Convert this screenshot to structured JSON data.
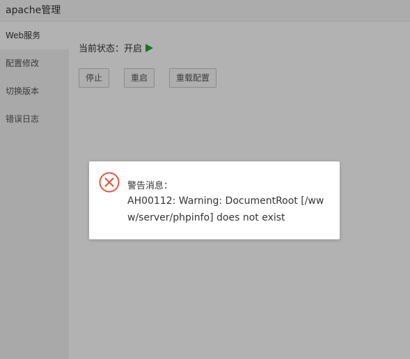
{
  "window": {
    "title": "apache管理"
  },
  "sidebar": {
    "items": [
      {
        "label": "Web服务",
        "active": true
      },
      {
        "label": "配置修改",
        "active": false
      },
      {
        "label": "切换版本",
        "active": false
      },
      {
        "label": "错误日志",
        "active": false
      }
    ]
  },
  "main": {
    "status_text": "当前状态：开启",
    "status_icon": "play-icon",
    "status_color": "#20a53a",
    "buttons": {
      "stop": "停止",
      "restart": "重启",
      "reload": "重载配置"
    }
  },
  "dialog": {
    "icon": "error-x-icon",
    "icon_color": "#e8533f",
    "heading": "警告消息：",
    "message": "AH00112: Warning: DocumentRoot [/www/server/phpinfo] does not exist"
  }
}
